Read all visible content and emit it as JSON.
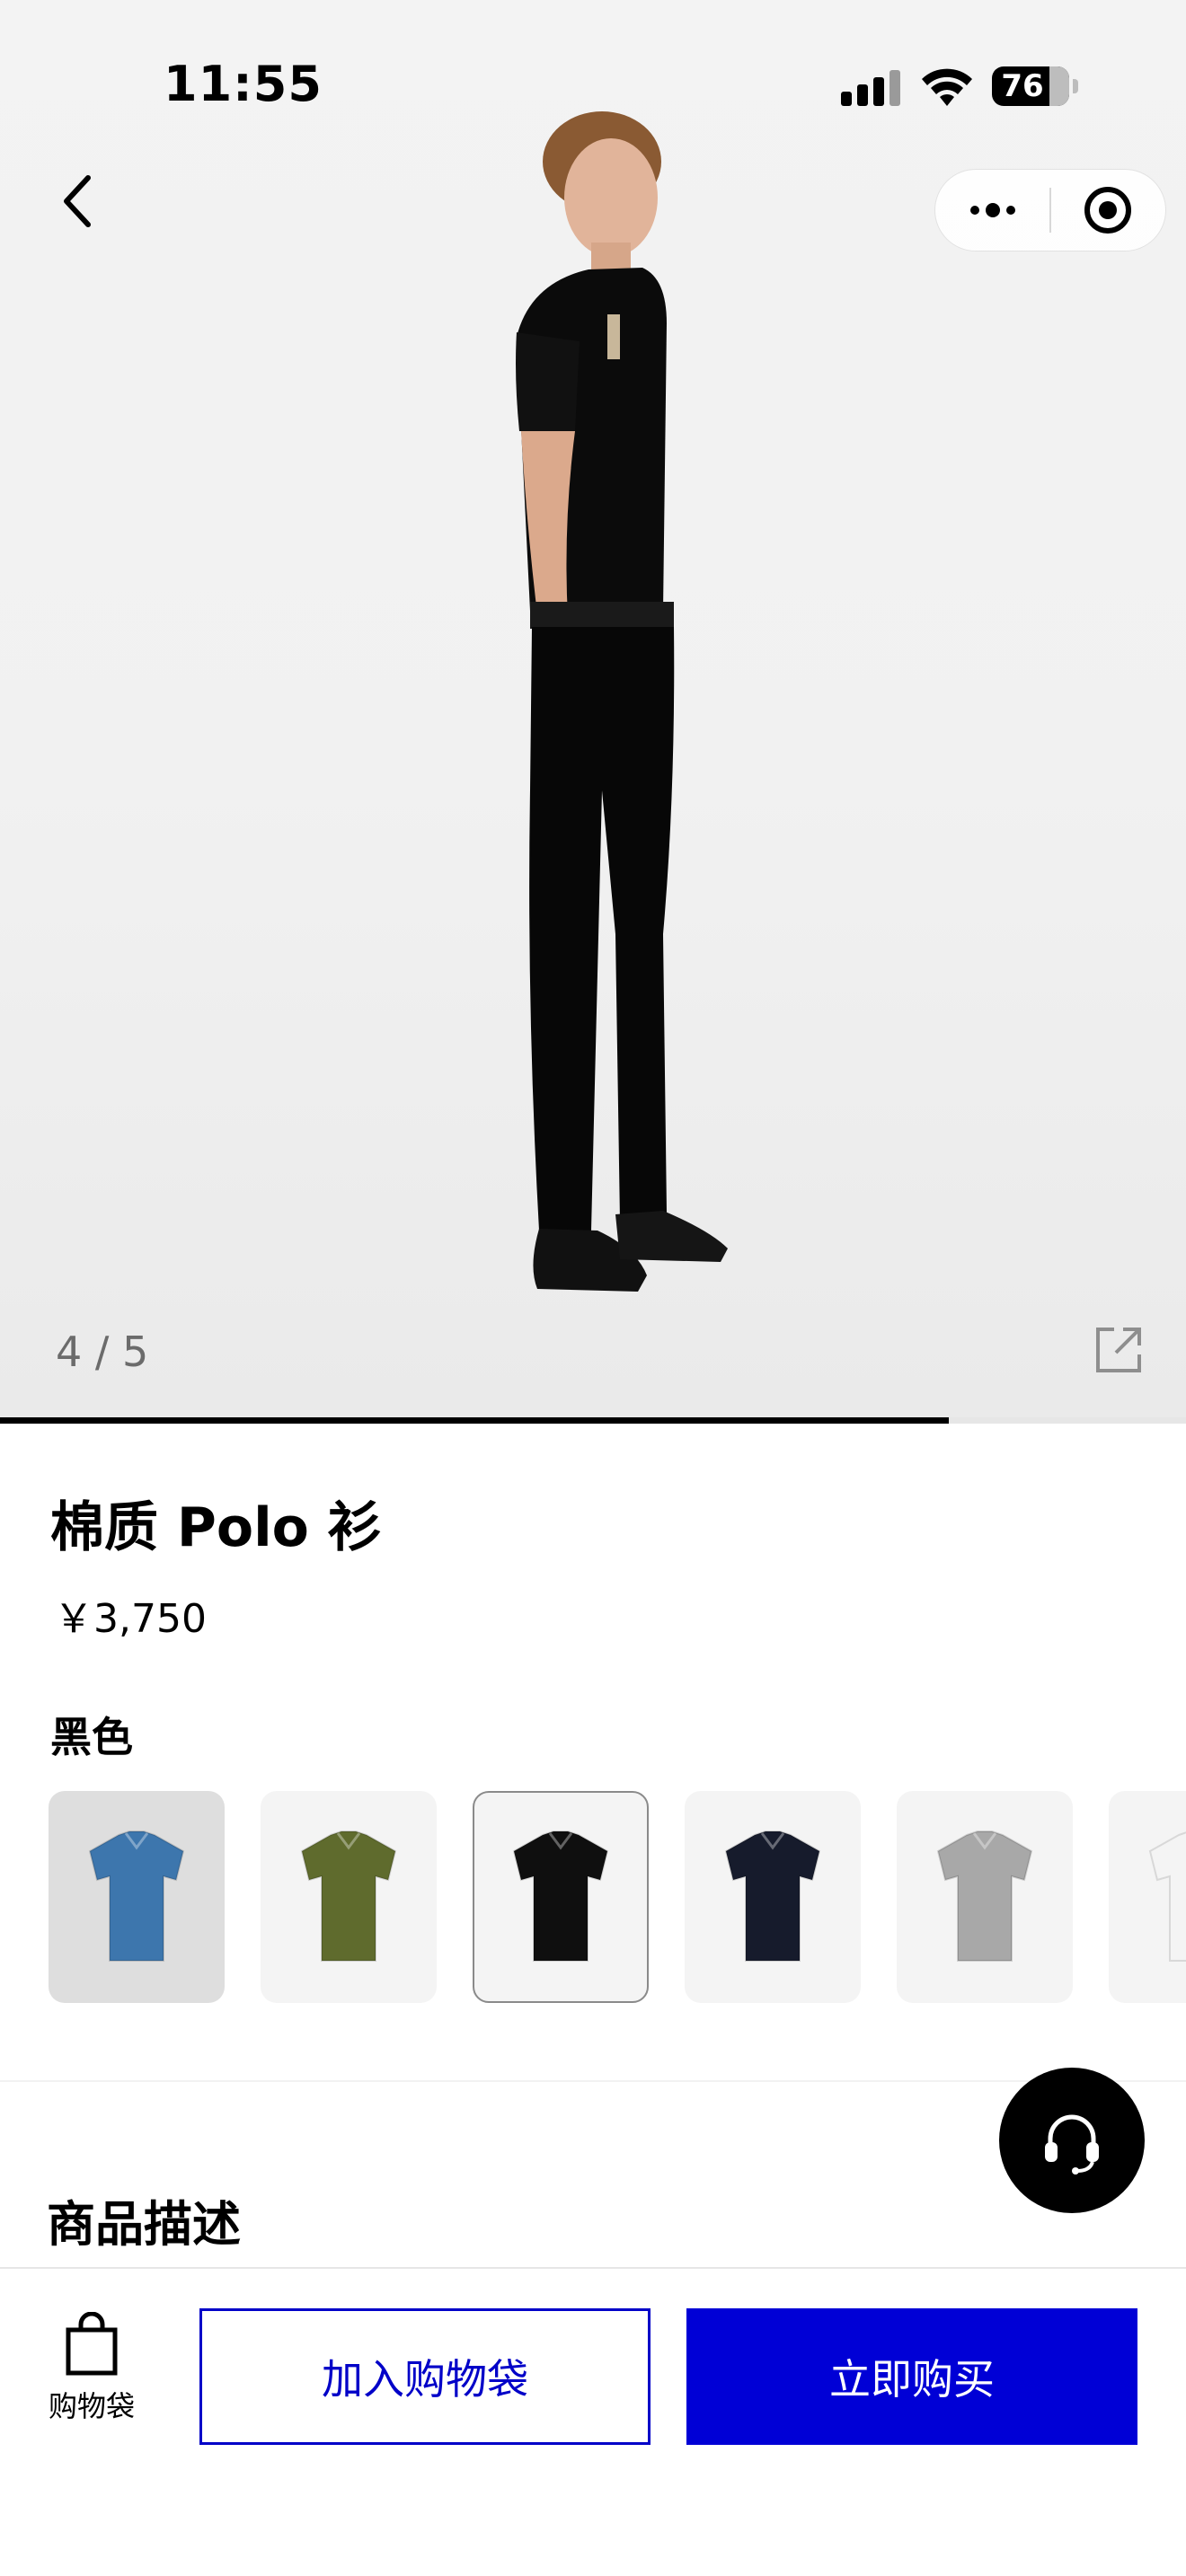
{
  "status_bar": {
    "time": "11:55",
    "battery": "76"
  },
  "gallery": {
    "current": 4,
    "total": 5,
    "counter_text": "4 / 5",
    "progress_fraction": 0.8
  },
  "product": {
    "title": "棉质 Polo 衫",
    "price": "￥3,750",
    "color_label": "黑色"
  },
  "swatches": [
    {
      "color": "#3d76ad",
      "state": "hover"
    },
    {
      "color": "#5f6b2d",
      "state": "normal"
    },
    {
      "color": "#0f0f0f",
      "state": "selected"
    },
    {
      "color": "#161b2c",
      "state": "normal"
    },
    {
      "color": "#a8a8a8",
      "state": "normal"
    },
    {
      "color": "#f4f4f4",
      "state": "normal"
    }
  ],
  "section": {
    "description_title": "商品描述"
  },
  "bottom_bar": {
    "bag_label": "购物袋",
    "add_to_bag": "加入购物袋",
    "buy_now": "立即购买"
  },
  "colors": {
    "accent": "#0000d6"
  },
  "icons": [
    "back-icon",
    "more-icon",
    "target-icon",
    "expand-icon",
    "headset-icon",
    "bag-icon"
  ]
}
